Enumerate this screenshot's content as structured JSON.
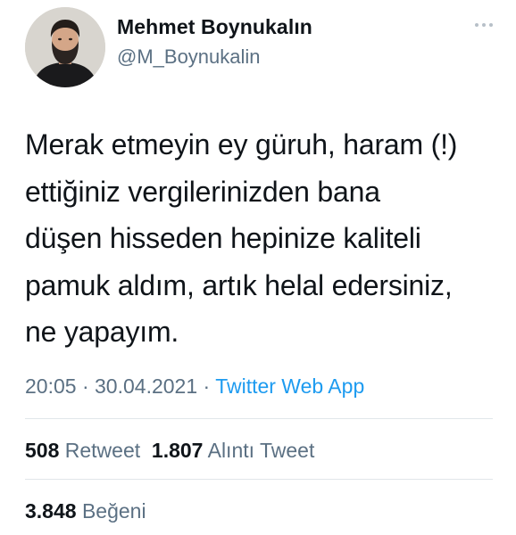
{
  "author": {
    "name": "Mehmet Boynukalın",
    "handle": "@M_Boynukalin"
  },
  "tweet": {
    "lines": [
      "Merak etmeyin ey güruh, haram (!)",
      "ettiğiniz vergilerinizden bana",
      "düşen hisseden hepinize kaliteli",
      "pamuk aldım, artık helal edersiniz,",
      "ne yapayım."
    ]
  },
  "meta": {
    "time": "20:05",
    "date": "30.04.2021",
    "separator": "·",
    "source": "Twitter Web App"
  },
  "stats": {
    "retweets": "508",
    "retweets_label": "Retweet",
    "quotes": "1.807",
    "quotes_label": "Alıntı Tweet",
    "likes": "3.848",
    "likes_label": "Beğeni"
  },
  "icons": {
    "more": "more-horizontal-icon"
  }
}
